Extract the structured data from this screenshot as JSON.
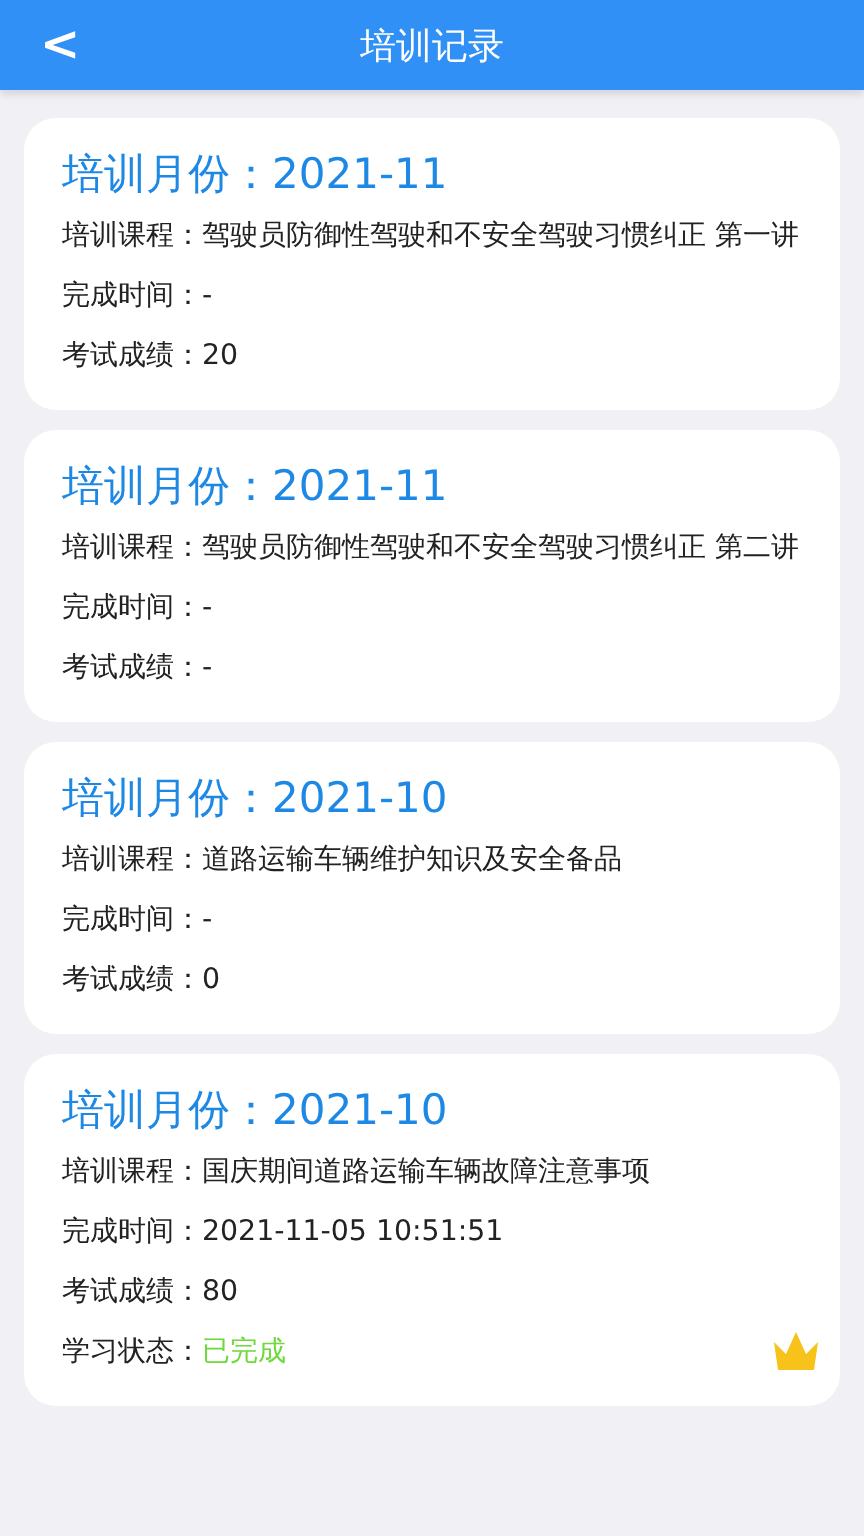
{
  "header": {
    "back": "<",
    "title": "培训记录"
  },
  "records": [
    {
      "title": "培训月份：2021-11",
      "fields": [
        {
          "kind": "text",
          "text": "培训课程：驾驶员防御性驾驶和不安全驾驶习惯纠正 第一讲"
        },
        {
          "kind": "text",
          "text": "完成时间：-"
        },
        {
          "kind": "text",
          "text": "考试成绩：20"
        }
      ]
    },
    {
      "title": "培训月份：2021-11",
      "fields": [
        {
          "kind": "text",
          "text": "培训课程：驾驶员防御性驾驶和不安全驾驶习惯纠正 第二讲"
        },
        {
          "kind": "text",
          "text": "完成时间：-"
        },
        {
          "kind": "text",
          "text": "考试成绩：-"
        }
      ]
    },
    {
      "title": "培训月份：2021-10",
      "fields": [
        {
          "kind": "text",
          "text": "培训课程：道路运输车辆维护知识及安全备品"
        },
        {
          "kind": "text",
          "text": "完成时间：-"
        },
        {
          "kind": "text",
          "text": "考试成绩：0"
        }
      ]
    },
    {
      "title": "培训月份：2021-10",
      "fields": [
        {
          "kind": "text",
          "text": "培训课程：国庆期间道路运输车辆故障注意事项"
        },
        {
          "kind": "text",
          "text": "完成时间：2021-11-05 10:51:51"
        },
        {
          "kind": "text",
          "text": "考试成绩：80"
        },
        {
          "kind": "status",
          "label": "学习状态：",
          "value": "已完成"
        }
      ]
    }
  ]
}
